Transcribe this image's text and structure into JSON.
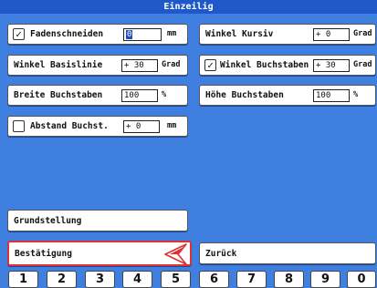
{
  "window": {
    "title": "Einzeilig"
  },
  "fields": {
    "fadenschneiden": {
      "label": "Fadenschneiden",
      "value": "0",
      "unit": "mm",
      "checked": true
    },
    "winkel_kursiv": {
      "label": "Winkel Kursiv",
      "value": "+ 0",
      "unit": "Grad"
    },
    "winkel_basislinie": {
      "label": "Winkel Basislinie",
      "value": "+ 30",
      "unit": "Grad"
    },
    "winkel_buchstaben": {
      "label": "Winkel Buchstaben",
      "value": "+ 30",
      "unit": "Grad",
      "checked": true
    },
    "breite_buchstaben": {
      "label": "Breite Buchstaben",
      "value": "100",
      "unit": "%"
    },
    "hoehe_buchstaben": {
      "label": "Höhe Buchstaben",
      "value": "100",
      "unit": "%"
    },
    "abstand_buchst": {
      "label": "Abstand Buchst.",
      "value": "+ 0",
      "unit": "mm",
      "checked": false
    }
  },
  "buttons": {
    "grundstellung": "Grundstellung",
    "bestaetigung": "Bestätigung",
    "zurueck": "Zurück"
  },
  "checkmark": "✓",
  "keypad": [
    "1",
    "2",
    "3",
    "4",
    "5",
    "6",
    "7",
    "8",
    "9",
    "0"
  ],
  "colors": {
    "background": "#3f7fe0",
    "titlebar": "#1f58c8",
    "accent": "#e03030",
    "selection": "#1e4fc0"
  },
  "icons": {
    "confirm": "red-arrow-icon"
  }
}
